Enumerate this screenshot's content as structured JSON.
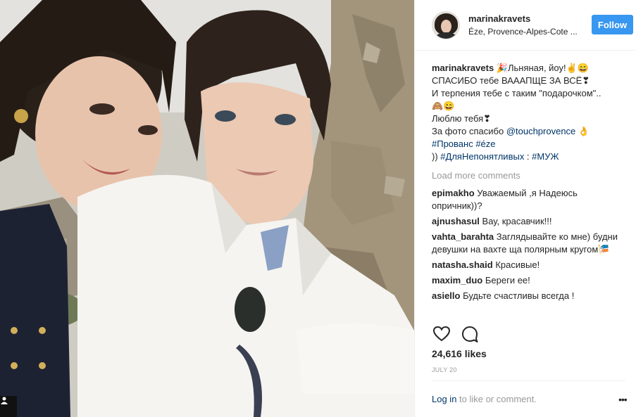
{
  "post": {
    "username": "marinakravets",
    "location": "Éze, Provence-Alpes-Cote ...",
    "follow_label": "Follow",
    "caption": {
      "username": "marinakravets",
      "lines": [
        " 🎉Льняная, йоу!✌😄",
        "СПАСИБО тебе ВАААПЩЕ ЗА ВСЁ❣",
        "И терпения тебе с таким \"подарочком\"..",
        "🙈😄",
        "Люблю тебя❣"
      ],
      "photo_credit_prefix": "За фото спасибо ",
      "photo_credit_link": "@touchprovence",
      "photo_credit_suffix": " 👌",
      "hashtag_line": "#Прованс #éze",
      "last_prefix": ")) ",
      "last_tag": "#ДляНепонятливых",
      "last_sep": " : ",
      "last_tag2": "#МУЖ"
    },
    "load_more_label": "Load more comments",
    "comments": [
      {
        "user": "epimakho",
        "text": " Уважаемый ,я Надеюсь опричник))?"
      },
      {
        "user": "ajnushasul",
        "text": " Вау, красавчик!!!"
      },
      {
        "user": "vahta_barahta",
        "text": " Заглядывайте ко мне) будни девушки на вахте ща полярным кругом🎏"
      },
      {
        "user": "natasha.shaid",
        "text": " Красивые!"
      },
      {
        "user": "maxim_duo",
        "text": " Береги ее!"
      },
      {
        "user": "asiello",
        "text": " Будьте счастливы всегда !"
      }
    ],
    "likes": "24,616 likes",
    "date": "JULY 20",
    "footer_login": "Log in",
    "footer_text": " to like or comment.",
    "more_label": "•••"
  },
  "icons": {
    "like": "heart-icon",
    "comment": "comment-bubble-icon",
    "badge": "user-tag-icon",
    "more": "more-options-icon"
  },
  "colors": {
    "follow_button": "#3897f0",
    "link": "#003569",
    "muted": "#999999",
    "text": "#262626"
  }
}
